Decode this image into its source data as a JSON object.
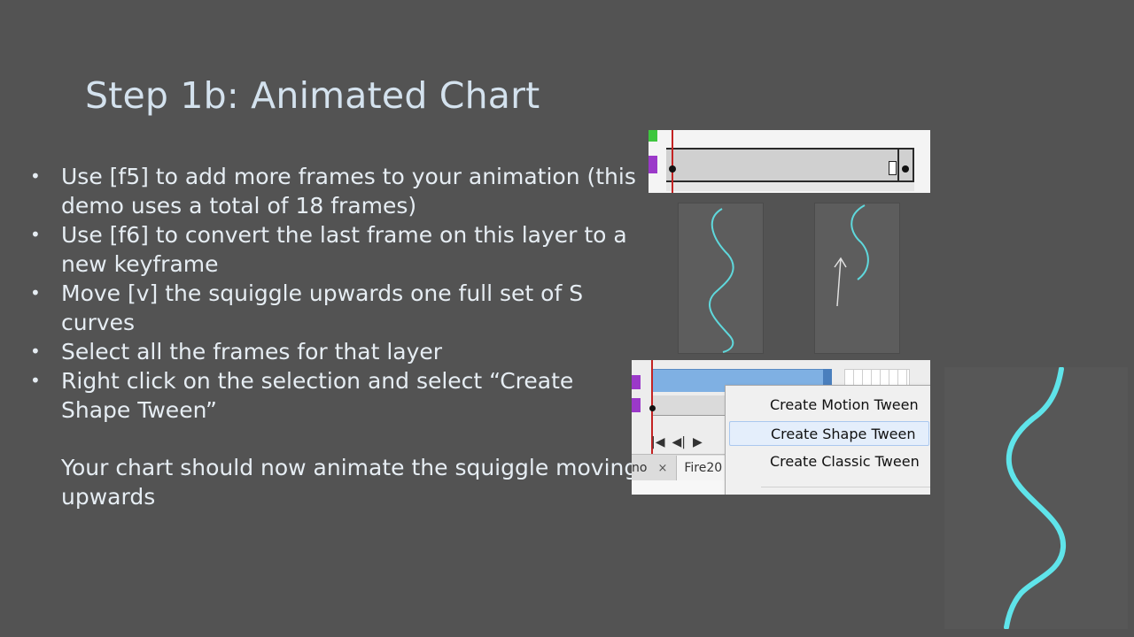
{
  "slide": {
    "title": "Step 1b: Animated Chart",
    "bullets": [
      "Use  [f5] to add more frames to your animation (this demo uses a total of 18 frames)",
      "Use [f6] to convert the last frame on this layer to a new keyframe",
      "Move [v] the squiggle upwards one full set of S curves",
      "Select all the frames for that layer",
      "Right click on the selection and select “Create Shape Tween”"
    ],
    "note": "Your chart should now animate the squiggle moving upwards"
  },
  "timeline2": {
    "tab_partial": "no",
    "tab_close": "×",
    "tab_name": "Fire20"
  },
  "context_menu": {
    "items": [
      "Create Motion Tween",
      "Create Shape Tween",
      "Create Classic Tween"
    ]
  },
  "colors": {
    "background": "#535353",
    "squiggle": "#5fd8dc",
    "playhead": "#c42323",
    "selection": "#7fb0e3"
  },
  "icons": [
    "go-to-first-frame-icon",
    "step-back-icon",
    "play-icon",
    "up-arrow-icon"
  ]
}
